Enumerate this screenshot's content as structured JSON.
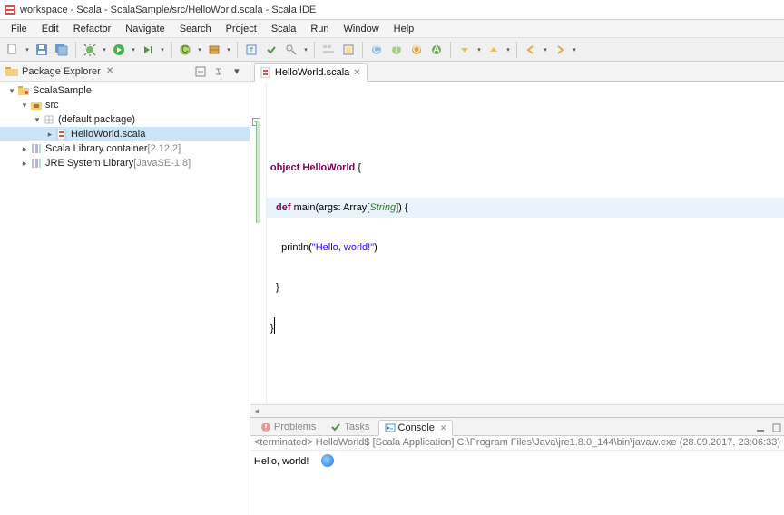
{
  "window": {
    "title": "workspace - Scala - ScalaSample/src/HelloWorld.scala - Scala IDE"
  },
  "menu": {
    "items": [
      "File",
      "Edit",
      "Refactor",
      "Navigate",
      "Search",
      "Project",
      "Scala",
      "Run",
      "Window",
      "Help"
    ]
  },
  "package_explorer": {
    "title": "Package Explorer",
    "project": "ScalaSample",
    "src": "src",
    "default_pkg": "(default package)",
    "file": "HelloWorld.scala",
    "scala_lib": "Scala Library container",
    "scala_lib_ver": " [2.12.2]",
    "jre_lib": "JRE System Library",
    "jre_lib_ver": " [JavaSE-1.8]"
  },
  "editor": {
    "tab": "HelloWorld.scala",
    "code": {
      "l1_kw1": "object",
      "l1_name": " HelloWorld",
      "l1_rest": " {",
      "l2_indent": "  ",
      "l2_kw": "def",
      "l2_name": " main",
      "l2_p1": "(args: Array[",
      "l2_gt": "String",
      "l2_p2": "]) {",
      "l3_indent": "    ",
      "l3_fn": "println",
      "l3_p1": "(",
      "l3_str": "\"Hello, world!\"",
      "l3_p2": ")",
      "l4_indent": "  ",
      "l4": "}",
      "l5": "}"
    }
  },
  "bottom": {
    "tabs": {
      "problems": "Problems",
      "tasks": "Tasks",
      "console": "Console"
    },
    "status": "<terminated> HelloWorld$ [Scala Application] C:\\Program Files\\Java\\jre1.8.0_144\\bin\\javaw.exe (28.09.2017, 23:06:33)",
    "output": "Hello, world!"
  }
}
